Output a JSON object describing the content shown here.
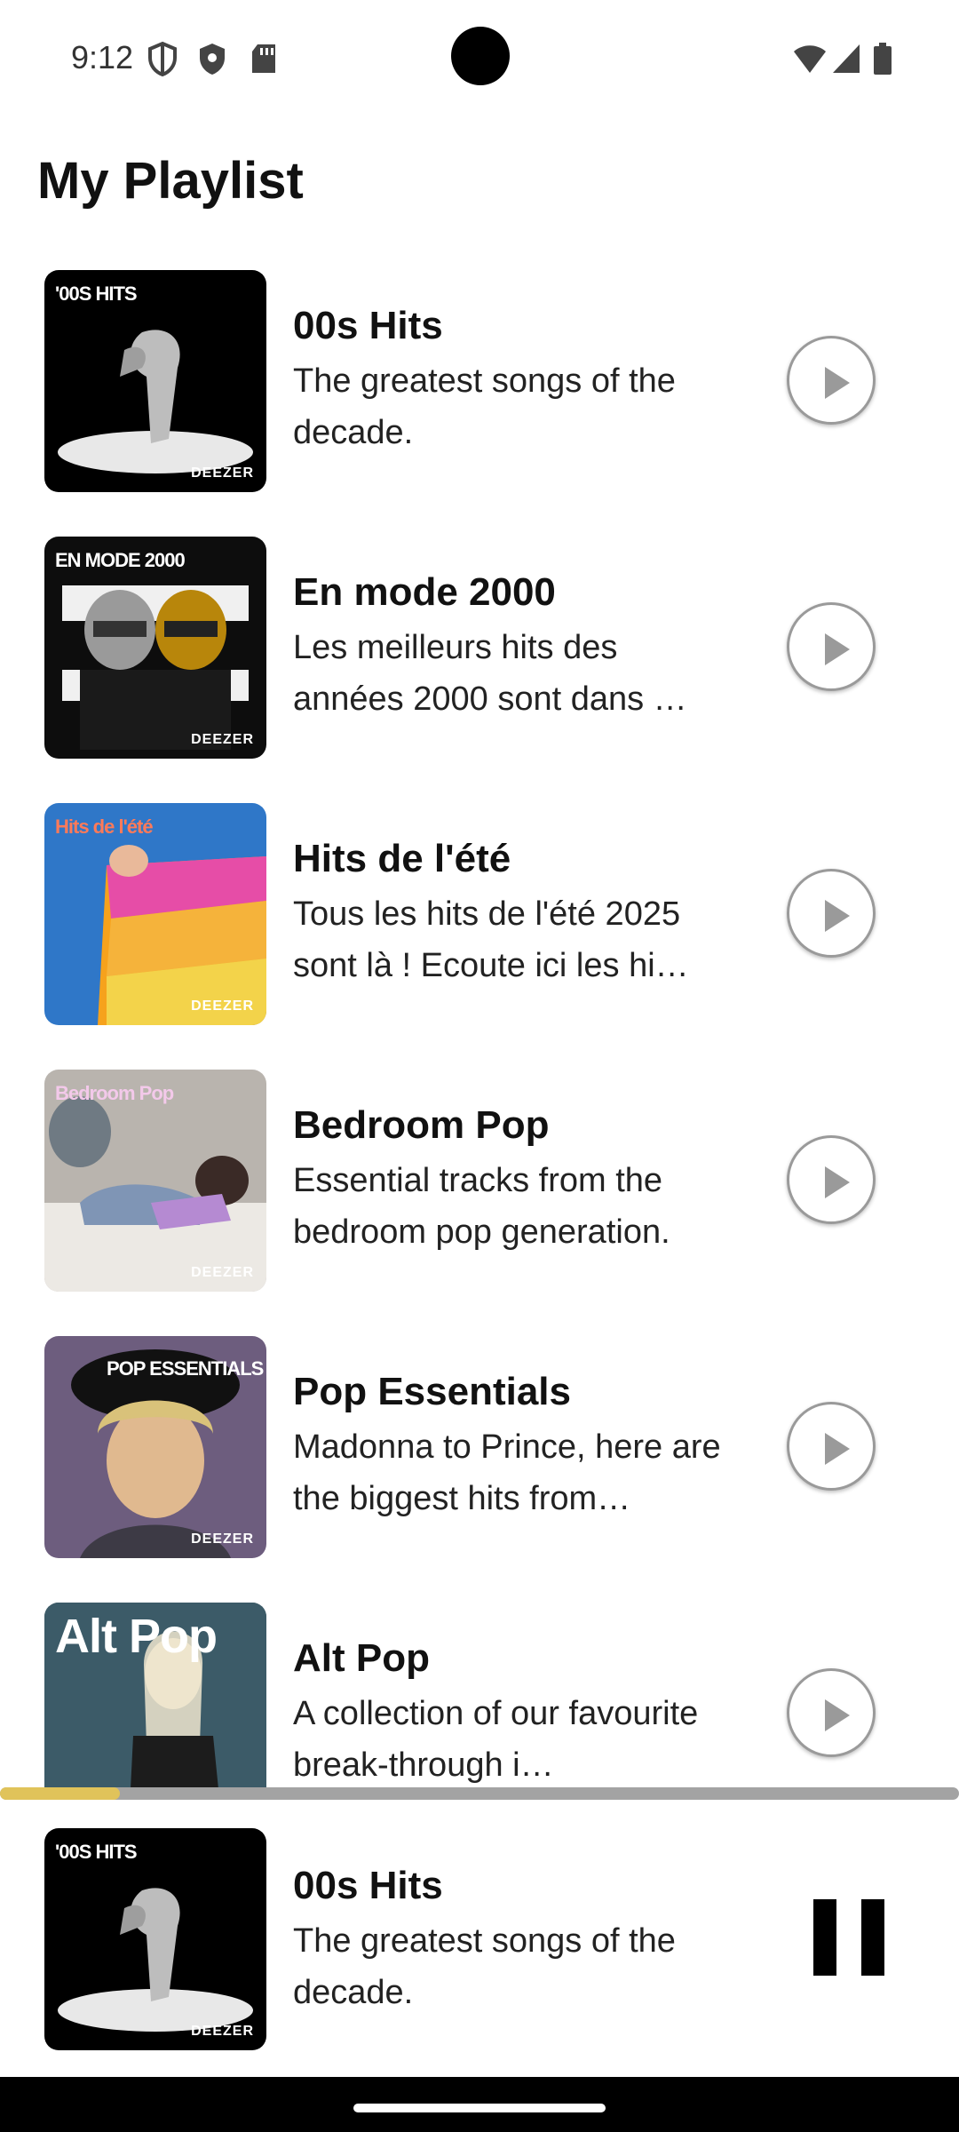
{
  "status_bar": {
    "time": "9:12",
    "icons": [
      "shield-outline-icon",
      "shield-icon",
      "sd-card-icon",
      "wifi-icon",
      "signal-icon",
      "battery-icon"
    ]
  },
  "page": {
    "title": "My Playlist"
  },
  "playlists": [
    {
      "title": "00s Hits",
      "description": "The greatest songs of the decade.",
      "cover_label": "'00S HITS",
      "brand": "DEEZER",
      "cover_color": "#000000"
    },
    {
      "title": "En mode 2000",
      "description": "Les meilleurs hits des années 2000 sont dans …",
      "cover_label": "EN MODE 2000",
      "brand": "DEEZER",
      "cover_color": "#0d0d0d"
    },
    {
      "title": "Hits de l'été",
      "description": "Tous les hits de l'été 2025 sont là ! Ecoute ici les hi…",
      "cover_label": "Hits de l'été",
      "brand": "DEEZER",
      "cover_color": "#2f77c8"
    },
    {
      "title": "Bedroom Pop",
      "description": "Essential tracks from the bedroom pop generation.",
      "cover_label": "Bedroom Pop",
      "brand": "DEEZER",
      "cover_color": "#b9b4ae"
    },
    {
      "title": "Pop Essentials",
      "description": "Madonna to Prince, here are the biggest hits from…",
      "cover_label": "POP ESSENTIALS",
      "brand": "DEEZER",
      "cover_color": "#6d5d7e"
    },
    {
      "title": "Alt Pop",
      "description": "A collection of our favourite break-through i…",
      "cover_label": "Alt Pop",
      "brand": "",
      "cover_color": "#304b57"
    }
  ],
  "player": {
    "title": "00s Hits",
    "description": "The greatest songs of the decade.",
    "cover_label": "'00S HITS",
    "brand": "DEEZER",
    "progress": 0.125,
    "progress_color": "#e0c35a",
    "state": "playing"
  }
}
